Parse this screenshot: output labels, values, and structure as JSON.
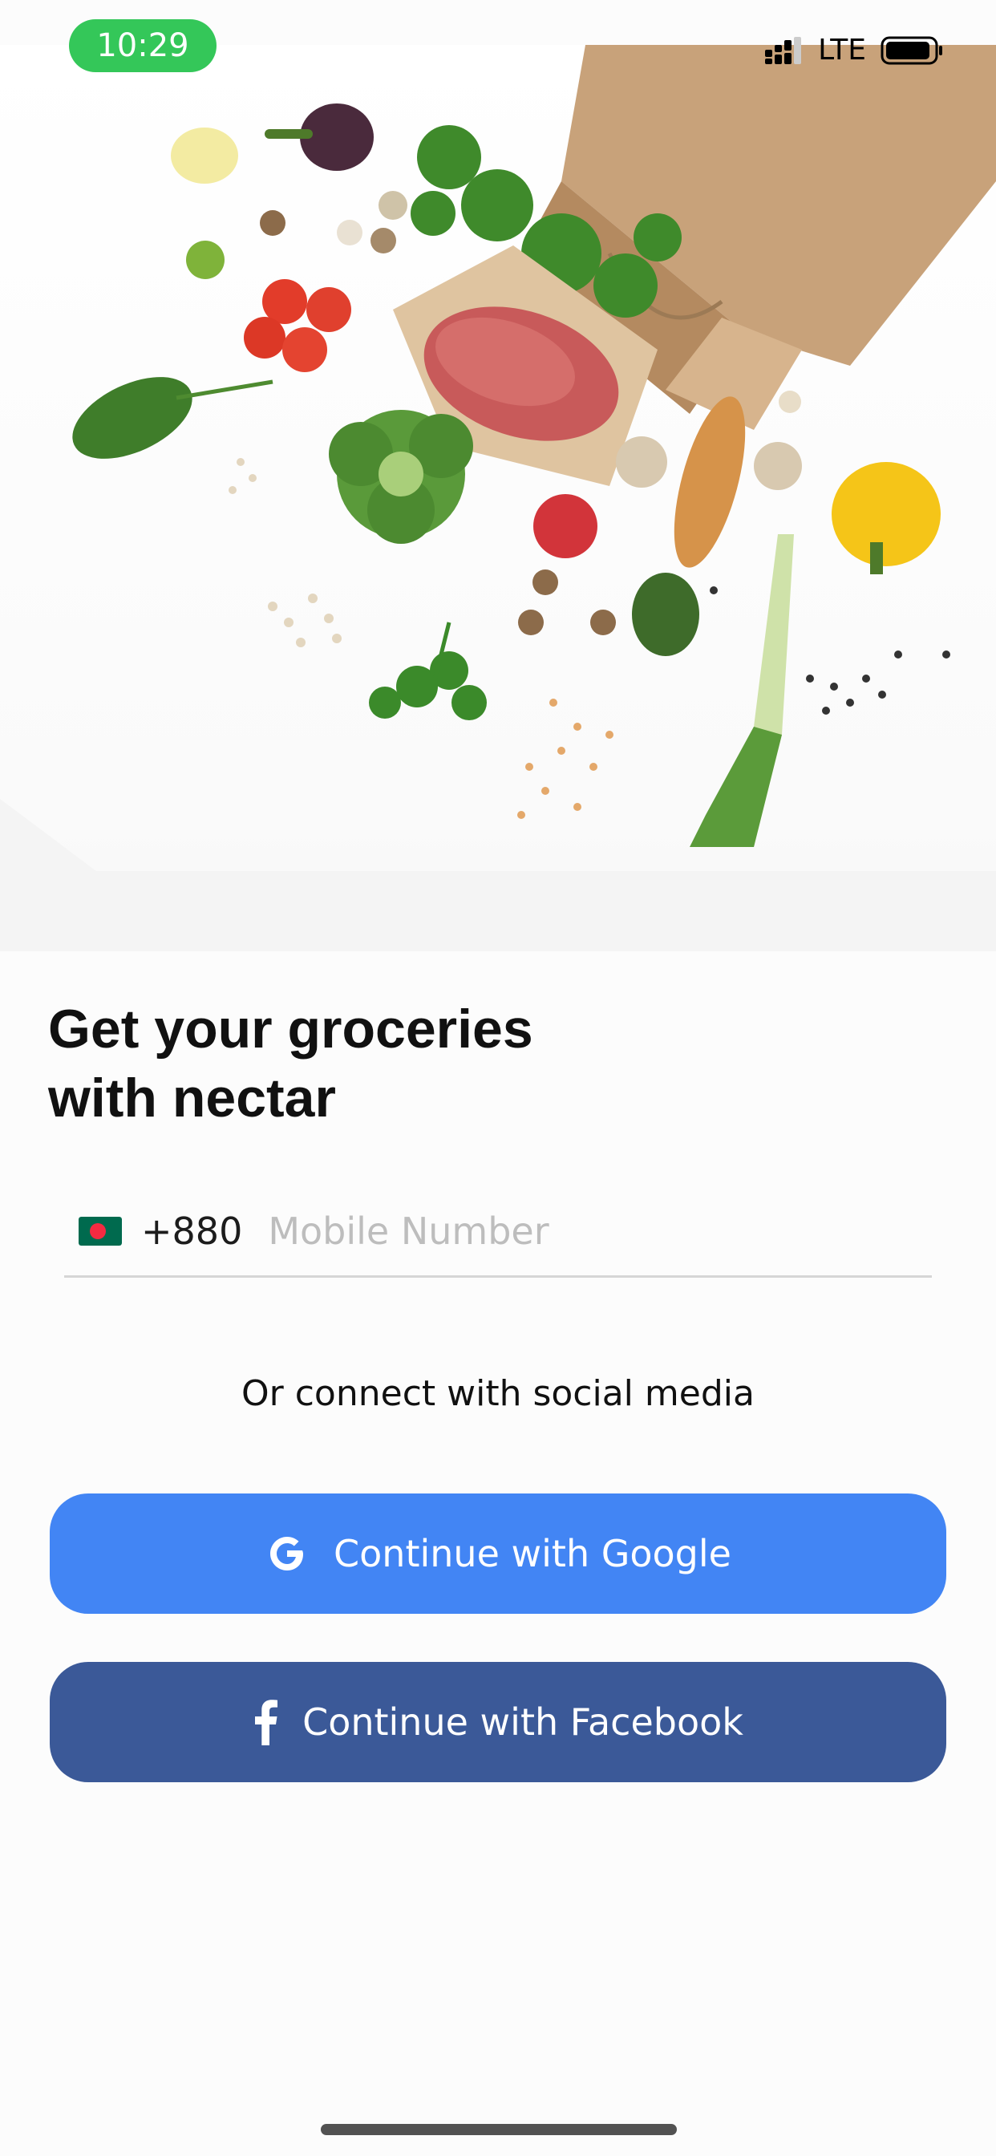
{
  "status_bar": {
    "time": "10:29",
    "network": "LTE",
    "time_pill_color": "#34c759"
  },
  "hero": {
    "icon": "groceries-photo"
  },
  "title": {
    "line1": "Get your groceries",
    "line2": "with nectar"
  },
  "phone": {
    "flag_icon": "bangladesh-flag-icon",
    "country_code": "+880",
    "placeholder": "Mobile Number",
    "value": ""
  },
  "social": {
    "label": "Or connect with social media",
    "google_label": "Continue with Google",
    "facebook_label": "Continue with Facebook",
    "google_color": "#4285f4",
    "facebook_color": "#3b5998"
  }
}
